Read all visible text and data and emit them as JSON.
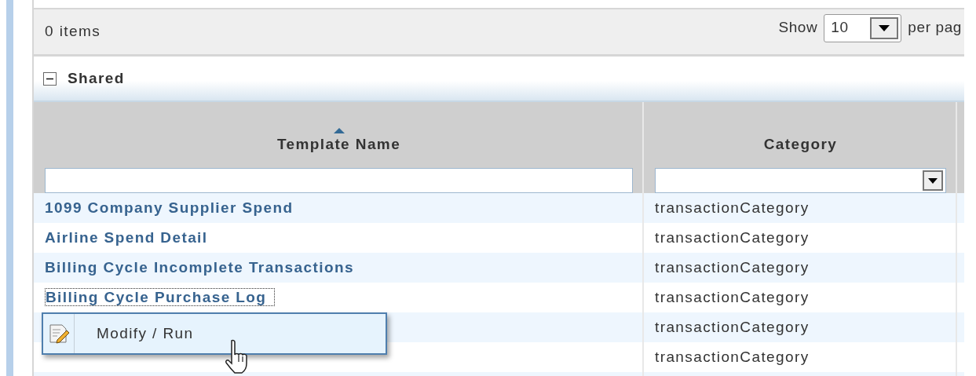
{
  "toolbar": {
    "item_count": "0 items",
    "show_label": "Show",
    "page_size": "10",
    "per_page_label": "per pag"
  },
  "group": {
    "label": "Shared",
    "expanded": true
  },
  "table": {
    "columns": [
      {
        "label": "Template Name",
        "sorted": true,
        "kind": "text"
      },
      {
        "label": "Category",
        "sorted": false,
        "kind": "select"
      }
    ],
    "rows": [
      {
        "name": "1099 Company Supplier Spend",
        "category": "transactionCategory"
      },
      {
        "name": "Airline Spend Detail",
        "category": "transactionCategory"
      },
      {
        "name": "Billing Cycle Incomplete Transactions",
        "category": "transactionCategory"
      },
      {
        "name": "Billing Cycle Purchase Log",
        "category": "transactionCategory",
        "focused": true
      },
      {
        "category": "transactionCategory"
      },
      {
        "category": "transactionCategory"
      }
    ]
  },
  "context_menu": {
    "items": [
      {
        "label": "Modify / Run"
      }
    ]
  }
}
